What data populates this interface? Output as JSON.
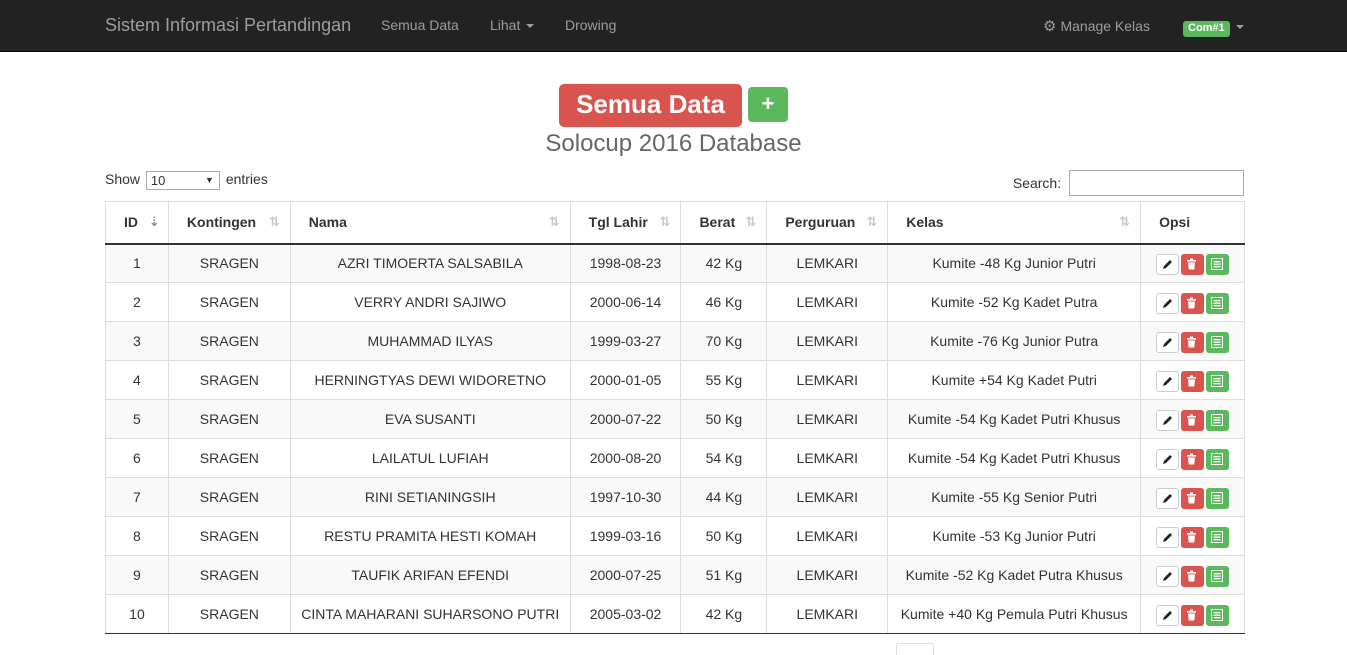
{
  "navbar": {
    "brand": "Sistem Informasi Pertandingan",
    "links": {
      "semua_data": "Semua Data",
      "lihat": "Lihat",
      "drowing": "Drowing"
    },
    "manage_kelas": "Manage Kelas",
    "user": "Com#1"
  },
  "header": {
    "title": "Semua Data",
    "add_label": "+",
    "subtitle": "Solocup 2016 Database"
  },
  "controls": {
    "show_label": "Show",
    "show_value": "10",
    "entries_label": "entries",
    "search_label": "Search:",
    "search_value": ""
  },
  "table": {
    "columns": [
      "ID",
      "Kontingen",
      "Nama",
      "Tgl Lahir",
      "Berat",
      "Perguruan",
      "Kelas",
      "Opsi"
    ],
    "rows": [
      [
        "1",
        "SRAGEN",
        "AZRI TIMOERTA SALSABILA",
        "1998-08-23",
        "42 Kg",
        "LEMKARI",
        "Kumite -48 Kg Junior Putri"
      ],
      [
        "2",
        "SRAGEN",
        "VERRY ANDRI SAJIWO",
        "2000-06-14",
        "46 Kg",
        "LEMKARI",
        "Kumite -52 Kg Kadet Putra"
      ],
      [
        "3",
        "SRAGEN",
        "MUHAMMAD ILYAS",
        "1999-03-27",
        "70 Kg",
        "LEMKARI",
        "Kumite -76 Kg Junior Putra"
      ],
      [
        "4",
        "SRAGEN",
        "HERNINGTYAS DEWI WIDORETNO",
        "2000-01-05",
        "55 Kg",
        "LEMKARI",
        "Kumite +54 Kg Kadet Putri"
      ],
      [
        "5",
        "SRAGEN",
        "EVA SUSANTI",
        "2000-07-22",
        "50 Kg",
        "LEMKARI",
        "Kumite -54 Kg Kadet Putri Khusus"
      ],
      [
        "6",
        "SRAGEN",
        "LAILATUL LUFIAH",
        "2000-08-20",
        "54 Kg",
        "LEMKARI",
        "Kumite -54 Kg Kadet Putri Khusus"
      ],
      [
        "7",
        "SRAGEN",
        "RINI SETIANINGSIH",
        "1997-10-30",
        "44 Kg",
        "LEMKARI",
        "Kumite -55 Kg Senior Putri"
      ],
      [
        "8",
        "SRAGEN",
        "RESTU PRAMITA HESTI KOMAH",
        "1999-03-16",
        "50 Kg",
        "LEMKARI",
        "Kumite -53 Kg Junior Putri"
      ],
      [
        "9",
        "SRAGEN",
        "TAUFIK ARIFAN EFENDI",
        "2000-07-25",
        "51 Kg",
        "LEMKARI",
        "Kumite -52 Kg Kadet Putra Khusus"
      ],
      [
        "10",
        "SRAGEN",
        "CINTA MAHARANI SUHARSONO PUTRI",
        "2005-03-02",
        "42 Kg",
        "LEMKARI",
        "Kumite +40 Kg Pemula Putri Khusus"
      ]
    ]
  },
  "icons": {
    "edit": "pencil-icon",
    "delete": "trash-icon",
    "detail": "list-icon",
    "settings": "gear-icon",
    "sort": "sort-icon"
  },
  "colors": {
    "danger": "#d9534f",
    "success": "#5cb85c",
    "navbar": "#222222"
  }
}
